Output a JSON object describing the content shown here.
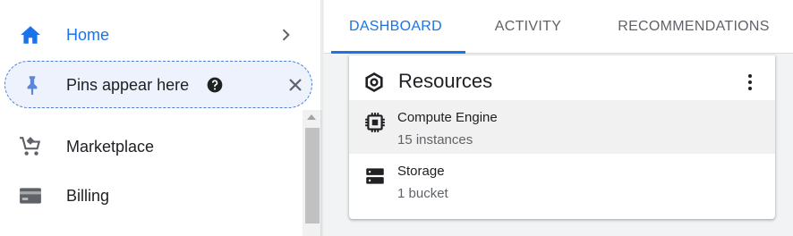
{
  "nav": {
    "home": {
      "label": "Home",
      "icon": "home-icon",
      "color": "#1a73e8"
    },
    "pins": {
      "label": "Pins appear here",
      "icon": "pin-icon"
    },
    "items": [
      {
        "label": "Marketplace",
        "icon": "marketplace-cart-icon"
      },
      {
        "label": "Billing",
        "icon": "billing-card-icon"
      }
    ]
  },
  "tabs": [
    {
      "label": "DASHBOARD",
      "active": true
    },
    {
      "label": "ACTIVITY",
      "active": false
    },
    {
      "label": "RECOMMENDATIONS",
      "active": false
    }
  ],
  "card": {
    "title": "Resources",
    "icon": "resources-hexagon-icon",
    "rows": [
      {
        "name": "Compute Engine",
        "detail": "15 instances",
        "icon": "chip-icon"
      },
      {
        "name": "Storage",
        "detail": "1 bucket",
        "icon": "storage-icon"
      }
    ]
  },
  "colors": {
    "accent": "#1a73e8",
    "pinsBackground": "#edf2fc",
    "pageBackground": "#f1f3f4"
  }
}
